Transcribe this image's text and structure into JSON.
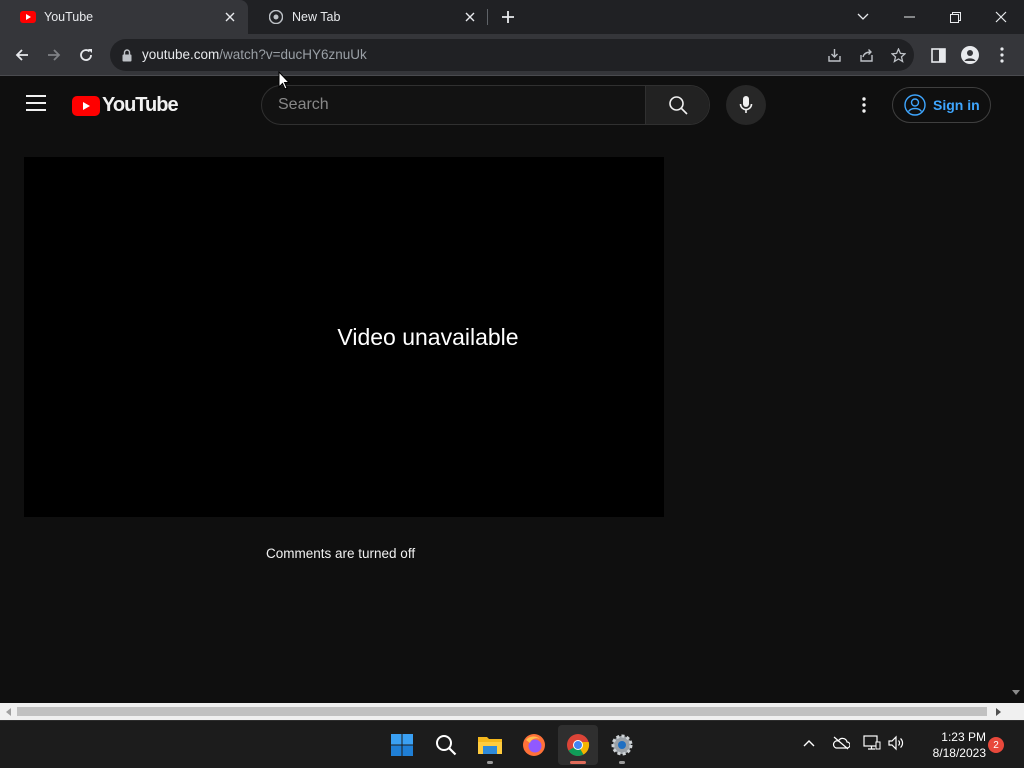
{
  "browser": {
    "tabs": [
      {
        "title": "YouTube",
        "active": true
      },
      {
        "title": "New Tab",
        "active": false
      }
    ],
    "url_host": "youtube.com",
    "url_path": "/watch?v=ducHY6znuUk"
  },
  "youtube": {
    "logo_text": "YouTube",
    "search_placeholder": "Search",
    "signin_label": "Sign in",
    "player_message": "Video unavailable",
    "comments_message": "Comments are turned off"
  },
  "taskbar": {
    "time": "1:23 PM",
    "date": "8/18/2023",
    "notification_count": "2"
  },
  "colors": {
    "yt_red": "#ff0000",
    "signin_blue": "#3ea6ff",
    "page_bg": "#0f0f0f"
  },
  "icons": [
    "youtube-favicon",
    "chrome-favicon",
    "close-icon",
    "plus-icon",
    "chevron-down-icon",
    "minimize-icon",
    "restore-icon",
    "back-icon",
    "forward-icon",
    "reload-icon",
    "lock-icon",
    "download-icon",
    "share-icon",
    "star-icon",
    "side-panel-icon",
    "profile-icon",
    "kebab-icon",
    "hamburger-icon",
    "search-icon",
    "mic-icon",
    "account-icon",
    "windows-start-icon",
    "file-explorer-icon",
    "firefox-icon",
    "chrome-icon",
    "settings-icon",
    "onedrive-icon",
    "network-icon",
    "volume-icon"
  ]
}
